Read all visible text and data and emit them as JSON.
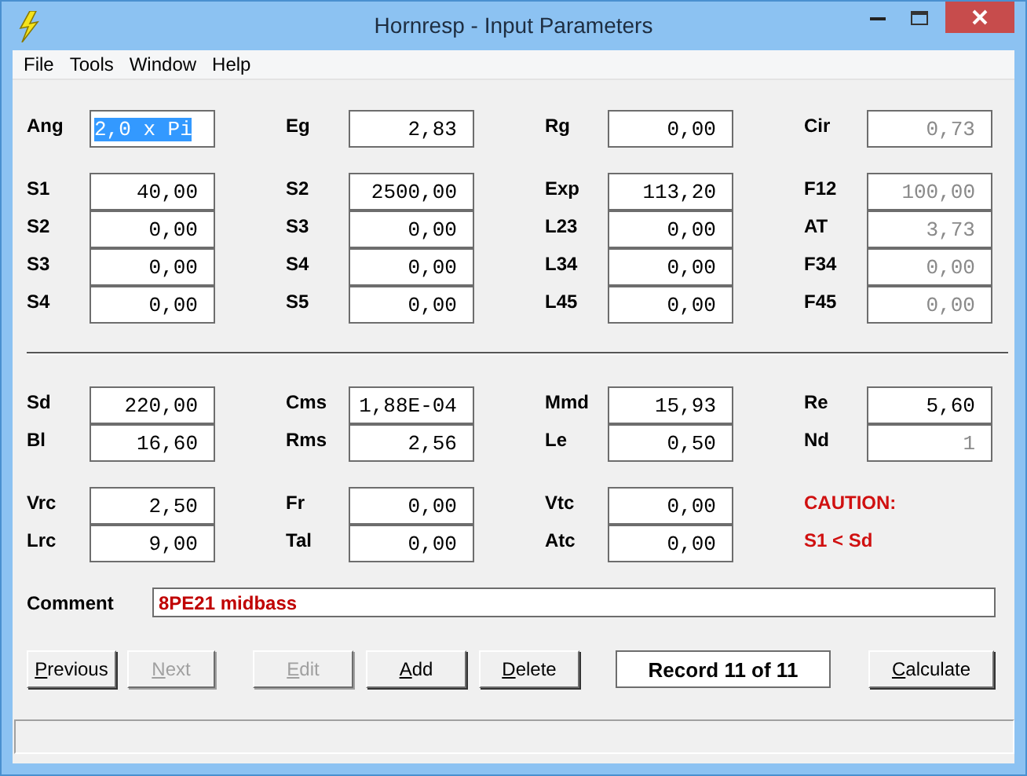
{
  "window": {
    "title": "Hornresp - Input Parameters"
  },
  "menu": [
    "File",
    "Tools",
    "Window",
    "Help"
  ],
  "groups": [
    {
      "rows": [
        [
          {
            "kind": "field",
            "label": "Ang",
            "value": "2,0 x Pi",
            "readonly": false,
            "selected": true
          },
          {
            "kind": "field",
            "label": "Eg",
            "value": "2,83",
            "readonly": false,
            "selected": false
          },
          {
            "kind": "field",
            "label": "Rg",
            "value": "0,00",
            "readonly": false,
            "selected": false
          },
          {
            "kind": "field",
            "label": "Cir",
            "value": "0,73",
            "readonly": true,
            "selected": false
          }
        ]
      ]
    },
    {
      "rows": [
        [
          {
            "kind": "field",
            "label": "S1",
            "value": "40,00",
            "readonly": false,
            "selected": false
          },
          {
            "kind": "field",
            "label": "S2",
            "value": "2500,00",
            "readonly": false,
            "selected": false
          },
          {
            "kind": "field",
            "label": "Exp",
            "value": "113,20",
            "readonly": false,
            "selected": false
          },
          {
            "kind": "field",
            "label": "F12",
            "value": "100,00",
            "readonly": true,
            "selected": false
          }
        ],
        [
          {
            "kind": "field",
            "label": "S2",
            "value": "0,00",
            "readonly": false,
            "selected": false
          },
          {
            "kind": "field",
            "label": "S3",
            "value": "0,00",
            "readonly": false,
            "selected": false
          },
          {
            "kind": "field",
            "label": "L23",
            "value": "0,00",
            "readonly": false,
            "selected": false
          },
          {
            "kind": "field",
            "label": "AT",
            "value": "3,73",
            "readonly": true,
            "selected": false
          }
        ],
        [
          {
            "kind": "field",
            "label": "S3",
            "value": "0,00",
            "readonly": false,
            "selected": false
          },
          {
            "kind": "field",
            "label": "S4",
            "value": "0,00",
            "readonly": false,
            "selected": false
          },
          {
            "kind": "field",
            "label": "L34",
            "value": "0,00",
            "readonly": false,
            "selected": false
          },
          {
            "kind": "field",
            "label": "F34",
            "value": "0,00",
            "readonly": true,
            "selected": false
          }
        ],
        [
          {
            "kind": "field",
            "label": "S4",
            "value": "0,00",
            "readonly": false,
            "selected": false
          },
          {
            "kind": "field",
            "label": "S5",
            "value": "0,00",
            "readonly": false,
            "selected": false
          },
          {
            "kind": "field",
            "label": "L45",
            "value": "0,00",
            "readonly": false,
            "selected": false
          },
          {
            "kind": "field",
            "label": "F45",
            "value": "0,00",
            "readonly": true,
            "selected": false
          }
        ]
      ]
    },
    {
      "divider": true,
      "rows": [
        [
          {
            "kind": "field",
            "label": "Sd",
            "value": "220,00",
            "readonly": false,
            "selected": false
          },
          {
            "kind": "field",
            "label": "Cms",
            "value": "1,88E-04",
            "readonly": false,
            "selected": false
          },
          {
            "kind": "field",
            "label": "Mmd",
            "value": "15,93",
            "readonly": false,
            "selected": false
          },
          {
            "kind": "field",
            "label": "Re",
            "value": "5,60",
            "readonly": false,
            "selected": false
          }
        ],
        [
          {
            "kind": "field",
            "label": "Bl",
            "value": "16,60",
            "readonly": false,
            "selected": false
          },
          {
            "kind": "field",
            "label": "Rms",
            "value": "2,56",
            "readonly": false,
            "selected": false
          },
          {
            "kind": "field",
            "label": "Le",
            "value": "0,50",
            "readonly": false,
            "selected": false
          },
          {
            "kind": "field",
            "label": "Nd",
            "value": "1",
            "readonly": true,
            "selected": false
          }
        ]
      ]
    },
    {
      "rows": [
        [
          {
            "kind": "field",
            "label": "Vrc",
            "value": "2,50",
            "readonly": false,
            "selected": false
          },
          {
            "kind": "field",
            "label": "Fr",
            "value": "0,00",
            "readonly": false,
            "selected": false
          },
          {
            "kind": "field",
            "label": "Vtc",
            "value": "0,00",
            "readonly": false,
            "selected": false
          },
          {
            "kind": "warning",
            "text": "CAUTION:"
          }
        ],
        [
          {
            "kind": "field",
            "label": "Lrc",
            "value": "9,00",
            "readonly": false,
            "selected": false
          },
          {
            "kind": "field",
            "label": "Tal",
            "value": "0,00",
            "readonly": false,
            "selected": false
          },
          {
            "kind": "field",
            "label": "Atc",
            "value": "0,00",
            "readonly": false,
            "selected": false
          },
          {
            "kind": "warning",
            "text": "S1 < Sd"
          }
        ]
      ]
    }
  ],
  "comment": {
    "label": "Comment",
    "value": "8PE21 midbass"
  },
  "buttons": [
    {
      "kind": "button",
      "label": "Previous",
      "disabled": false,
      "underline_first": true
    },
    {
      "kind": "button",
      "label": "Next",
      "disabled": true,
      "underline_first": true
    },
    {
      "kind": "button",
      "label": "Edit",
      "disabled": true,
      "underline_first": true
    },
    {
      "kind": "button",
      "label": "Add",
      "disabled": false,
      "underline_first": true
    },
    {
      "kind": "button",
      "label": "Delete",
      "disabled": false,
      "underline_first": true
    },
    {
      "kind": "display",
      "label": "Record 11 of 11"
    },
    {
      "kind": "button",
      "label": "Calculate",
      "disabled": false,
      "underline_first": true
    }
  ]
}
